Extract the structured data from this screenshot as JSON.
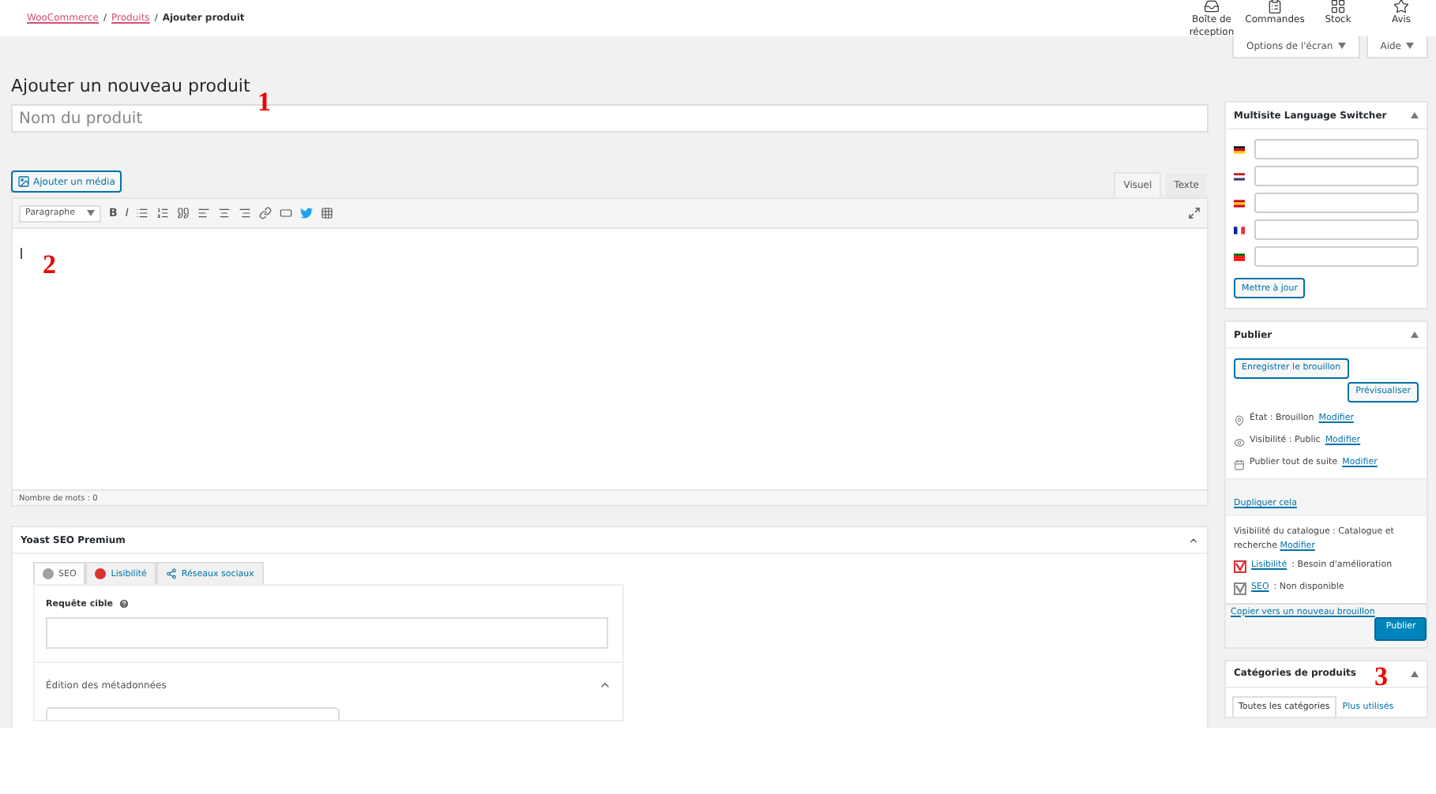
{
  "breadcrumb_separator": "/",
  "breadcrumb": [
    {
      "label": "WooCommerce",
      "link": true
    },
    {
      "label": "Produits",
      "link": true
    },
    {
      "label": "Ajouter produit",
      "link": false
    }
  ],
  "header_actions": [
    {
      "label": "Boîte de réception",
      "kind": "inbox"
    },
    {
      "label": "Commandes",
      "kind": "orders"
    },
    {
      "label": "Stock",
      "kind": "stock"
    },
    {
      "label": "Avis",
      "kind": "reviews"
    }
  ],
  "screen_options": "Options de l'écran",
  "help": "Aide",
  "page_title": "Ajouter un nouveau produit",
  "title_field": {
    "placeholder": "Nom du produit"
  },
  "annotations": [
    "1",
    "2",
    "3"
  ],
  "editor": {
    "add_media": "Ajouter un média",
    "mode_tabs": [
      {
        "label": "Visuel",
        "selected": true
      },
      {
        "label": "Texte",
        "selected": false
      }
    ],
    "format": "Paragraphe",
    "toolbar": [
      {
        "kind": "bold",
        "label": "B"
      },
      {
        "kind": "italic",
        "label": "I"
      },
      {
        "kind": "ul"
      },
      {
        "kind": "ol"
      },
      {
        "kind": "quote"
      },
      {
        "kind": "left"
      },
      {
        "kind": "center"
      },
      {
        "kind": "right"
      },
      {
        "kind": "link"
      },
      {
        "kind": "more"
      },
      {
        "kind": "twitter"
      },
      {
        "kind": "kitchen"
      }
    ],
    "word_count": "Nombre de mots : 0"
  },
  "yoast": {
    "title": "Yoast SEO Premium",
    "tabs": [
      {
        "label": "SEO",
        "kind": "dot",
        "color": "#a0a0a0",
        "selected": true
      },
      {
        "label": "Lisibilité",
        "kind": "dot",
        "color": "#dc3232",
        "selected": false
      },
      {
        "label": "Réseaux sociaux",
        "kind": "share",
        "selected": false
      }
    ],
    "focus_label": "Requête cible",
    "metadata_label": "Édition des métadonnées"
  },
  "language_switcher": {
    "title": "Multisite Language Switcher",
    "languages": [
      {
        "kind": "de"
      },
      {
        "kind": "us"
      },
      {
        "kind": "es"
      },
      {
        "kind": "fr"
      },
      {
        "kind": "pt"
      }
    ],
    "update": "Mettre à jour"
  },
  "publish": {
    "title": "Publier",
    "save_draft": "Enregistrer le brouillon",
    "preview": "Prévisualiser",
    "rows": [
      {
        "kind": "pin",
        "label": "État : Brouillon",
        "link": "Modifier"
      },
      {
        "kind": "eye",
        "label": "Visibilité : Public",
        "link": "Modifier"
      },
      {
        "kind": "calendar",
        "label": "Publier tout de suite",
        "link": "Modifier"
      }
    ],
    "duplicate": "Dupliquer cela",
    "catalog": "Visibilité du catalogue : Catalogue et recherche",
    "catalog_link": "Modifier",
    "scores": [
      {
        "kind": "bad",
        "link": "Lisibilité",
        "text": " : Besoin d'amélioration"
      },
      {
        "kind": "none",
        "link": "SEO",
        "text": " : Non disponible"
      }
    ],
    "copy": "Copier vers un nouveau brouillon",
    "publish": "Publier"
  },
  "categories": {
    "title": "Catégories de produits",
    "tabs": [
      {
        "label": "Toutes les catégories",
        "selected": true
      },
      {
        "label": "Plus utilisés",
        "selected": false
      }
    ]
  }
}
